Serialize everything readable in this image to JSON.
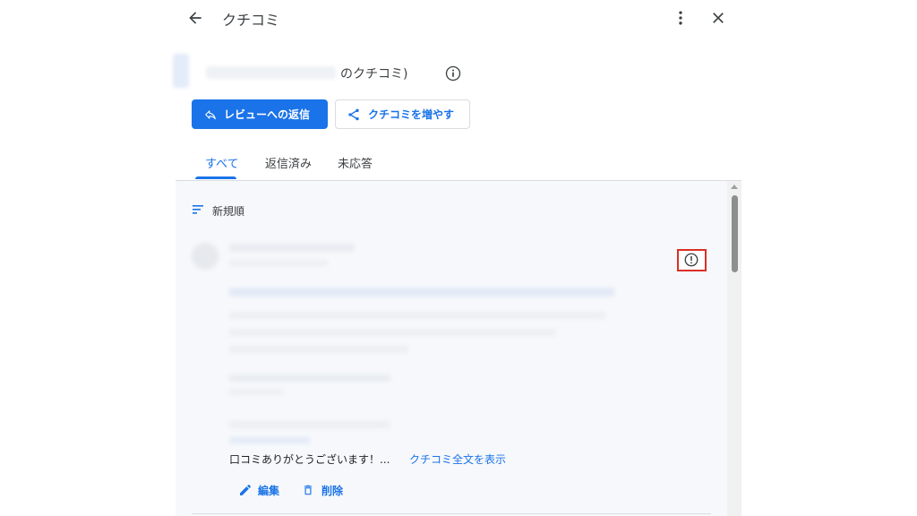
{
  "header": {
    "title": "クチコミ"
  },
  "business": {
    "title_suffix": "のクチコミ)"
  },
  "actions": {
    "reply_label": "レビューへの返信",
    "more_reviews_label": "クチコミを増やす"
  },
  "tabs": [
    {
      "label": "すべて",
      "active": true
    },
    {
      "label": "返信済み",
      "active": false
    },
    {
      "label": "未応答",
      "active": false
    }
  ],
  "sort": {
    "label": "新規順"
  },
  "review": {
    "reply_text": "口コミありがとうございます！...",
    "show_full_link": "クチコミ全文を表示",
    "edit_label": "編集",
    "delete_label": "削除"
  },
  "colors": {
    "accent": "#1a73e8",
    "highlight_box": "#d93025"
  }
}
